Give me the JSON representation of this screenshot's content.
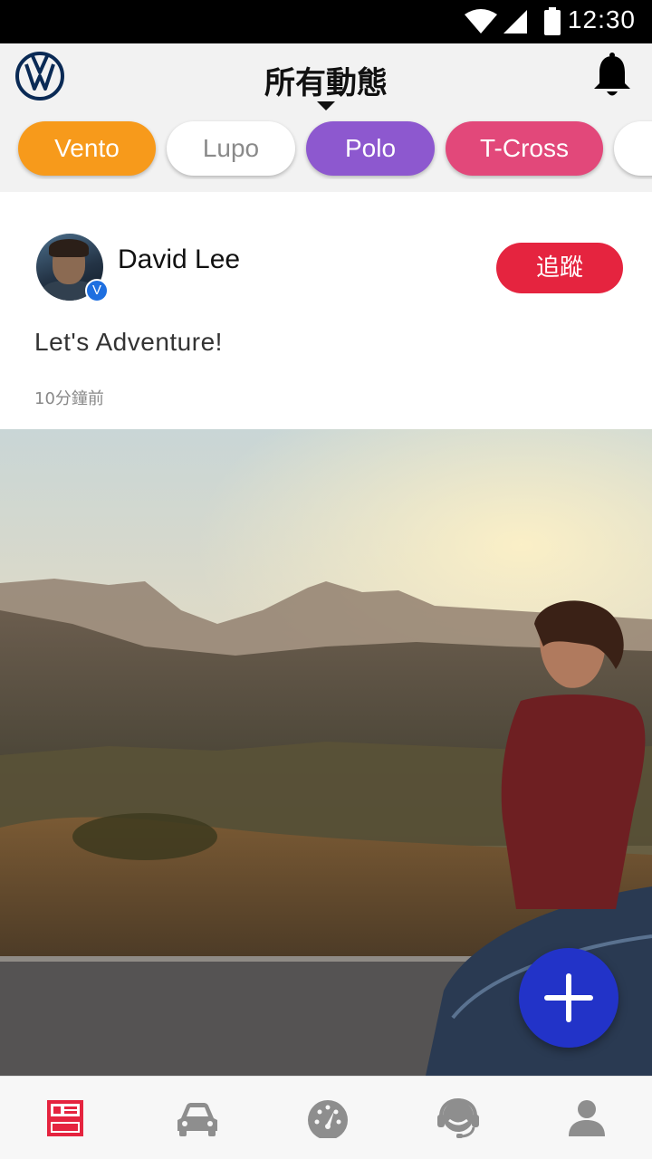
{
  "status_bar": {
    "time": "12:30",
    "icons": [
      "wifi-icon",
      "cellular-signal-icon",
      "battery-icon"
    ]
  },
  "header": {
    "logo": "volkswagen-logo",
    "title": "所有動態",
    "notification_icon": "bell-icon"
  },
  "filter_chips": [
    {
      "label": "Vento",
      "color": "#f79a1b",
      "selected": true
    },
    {
      "label": "Lupo",
      "color": "#ffffff",
      "selected": false
    },
    {
      "label": "Polo",
      "color": "#8d58cf",
      "selected": true
    },
    {
      "label": "T-Cross",
      "color": "#e2487a",
      "selected": true
    },
    {
      "label": "",
      "color": "#ffffff",
      "selected": false
    }
  ],
  "post": {
    "author": "David Lee",
    "verified_badge": "V",
    "follow_label": "追蹤",
    "text": "Let's Adventure!",
    "time_ago": "10分鐘前"
  },
  "fab": {
    "icon": "plus-icon"
  },
  "bottom_nav": [
    {
      "icon": "news-feed-icon",
      "active": true
    },
    {
      "icon": "car-icon",
      "active": false
    },
    {
      "icon": "dashboard-gauge-icon",
      "active": false
    },
    {
      "icon": "support-headset-icon",
      "active": false
    },
    {
      "icon": "profile-icon",
      "active": false
    }
  ],
  "colors": {
    "accent_red": "#e5243f",
    "fab_blue": "#2233c8",
    "nav_active": "#e5243f",
    "nav_inactive": "#8e8e8e"
  }
}
